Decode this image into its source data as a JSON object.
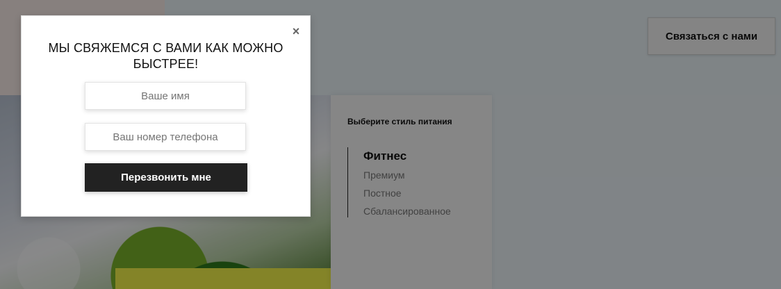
{
  "header": {
    "contact_button": "Связаться с нами"
  },
  "diet_panel": {
    "title": "Выберите стиль питания",
    "items": [
      {
        "label": "Фитнес",
        "active": true
      },
      {
        "label": "Премиум",
        "active": false
      },
      {
        "label": "Постное",
        "active": false
      },
      {
        "label": "Сбалансированное",
        "active": false
      }
    ]
  },
  "modal": {
    "title": "МЫ СВЯЖЕМСЯ С ВАМИ КАК МОЖНО БЫСТРЕЕ!",
    "close_icon": "close-icon",
    "name_placeholder": "Ваше имя",
    "phone_placeholder": "Ваш номер телефона",
    "submit_label": "Перезвонить мне"
  },
  "colors": {
    "overlay": "#000000",
    "accent_yellow": "#f0f04a",
    "submit_bg": "#222222"
  }
}
